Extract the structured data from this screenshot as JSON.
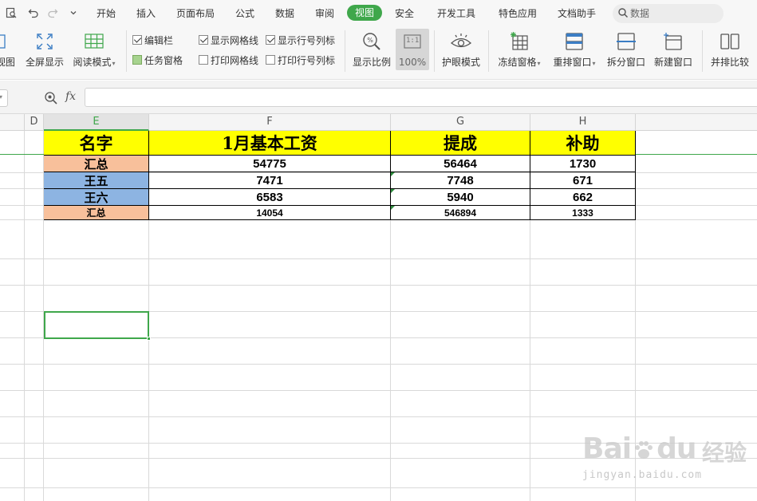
{
  "menubar": {
    "tabs": [
      {
        "id": "start",
        "label": "开始"
      },
      {
        "id": "insert",
        "label": "插入"
      },
      {
        "id": "layout",
        "label": "页面布局"
      },
      {
        "id": "formula",
        "label": "公式"
      },
      {
        "id": "data",
        "label": "数据"
      },
      {
        "id": "review",
        "label": "审阅"
      },
      {
        "id": "view",
        "label": "视图",
        "active": true
      },
      {
        "id": "security",
        "label": "安全"
      },
      {
        "id": "devtools",
        "label": "开发工具"
      },
      {
        "id": "special",
        "label": "特色应用"
      },
      {
        "id": "docassist",
        "label": "文档助手"
      }
    ],
    "search_text": "数据"
  },
  "ribbon": {
    "view_label": "视图",
    "fullscreen_label": "全屏显示",
    "read_mode_label": "阅读模式",
    "checkboxes": {
      "edit_bar": {
        "label": "编辑栏",
        "checked": true
      },
      "task_pane": {
        "label": "任务窗格",
        "checked": true
      },
      "show_gridlines": {
        "label": "显示网格线",
        "checked": true
      },
      "print_gridlines": {
        "label": "打印网格线",
        "checked": false
      },
      "show_headings": {
        "label": "显示行号列标",
        "checked": true
      },
      "print_headings": {
        "label": "打印行号列标",
        "checked": false
      }
    },
    "zoom_label": "显示比例",
    "zoom100_label": "100%",
    "zoom100_icon_text": "1:1",
    "eye_mode_label": "护眼模式",
    "freeze_label": "冻结窗格",
    "arrange_label": "重排窗口",
    "split_label": "拆分窗口",
    "new_window_label": "新建窗口",
    "compare_label": "并排比较"
  },
  "formula_bar": {
    "fx_label": "fx",
    "content": ""
  },
  "columns": [
    "D",
    "E",
    "F",
    "G",
    "H"
  ],
  "selected_column": "E",
  "table": {
    "headers": [
      "名字",
      "1月基本工资",
      "提成",
      "补助"
    ],
    "rows": [
      [
        "汇总",
        "54775",
        "56464",
        "1730"
      ],
      [
        "王五",
        "7471",
        "7748",
        "671"
      ],
      [
        "王六",
        "6583",
        "5940",
        "662"
      ],
      [
        "汇总",
        "14054",
        "546894",
        "1333"
      ]
    ]
  },
  "colors": {
    "accent": "#3fa74b",
    "header_fill": "#ffff00",
    "peach": "#f8c09b",
    "blue": "#8db4e2"
  },
  "watermark": {
    "brand": "Bai",
    "brand2": "du",
    "cn": "经验",
    "url": "jingyan.baidu.com"
  }
}
